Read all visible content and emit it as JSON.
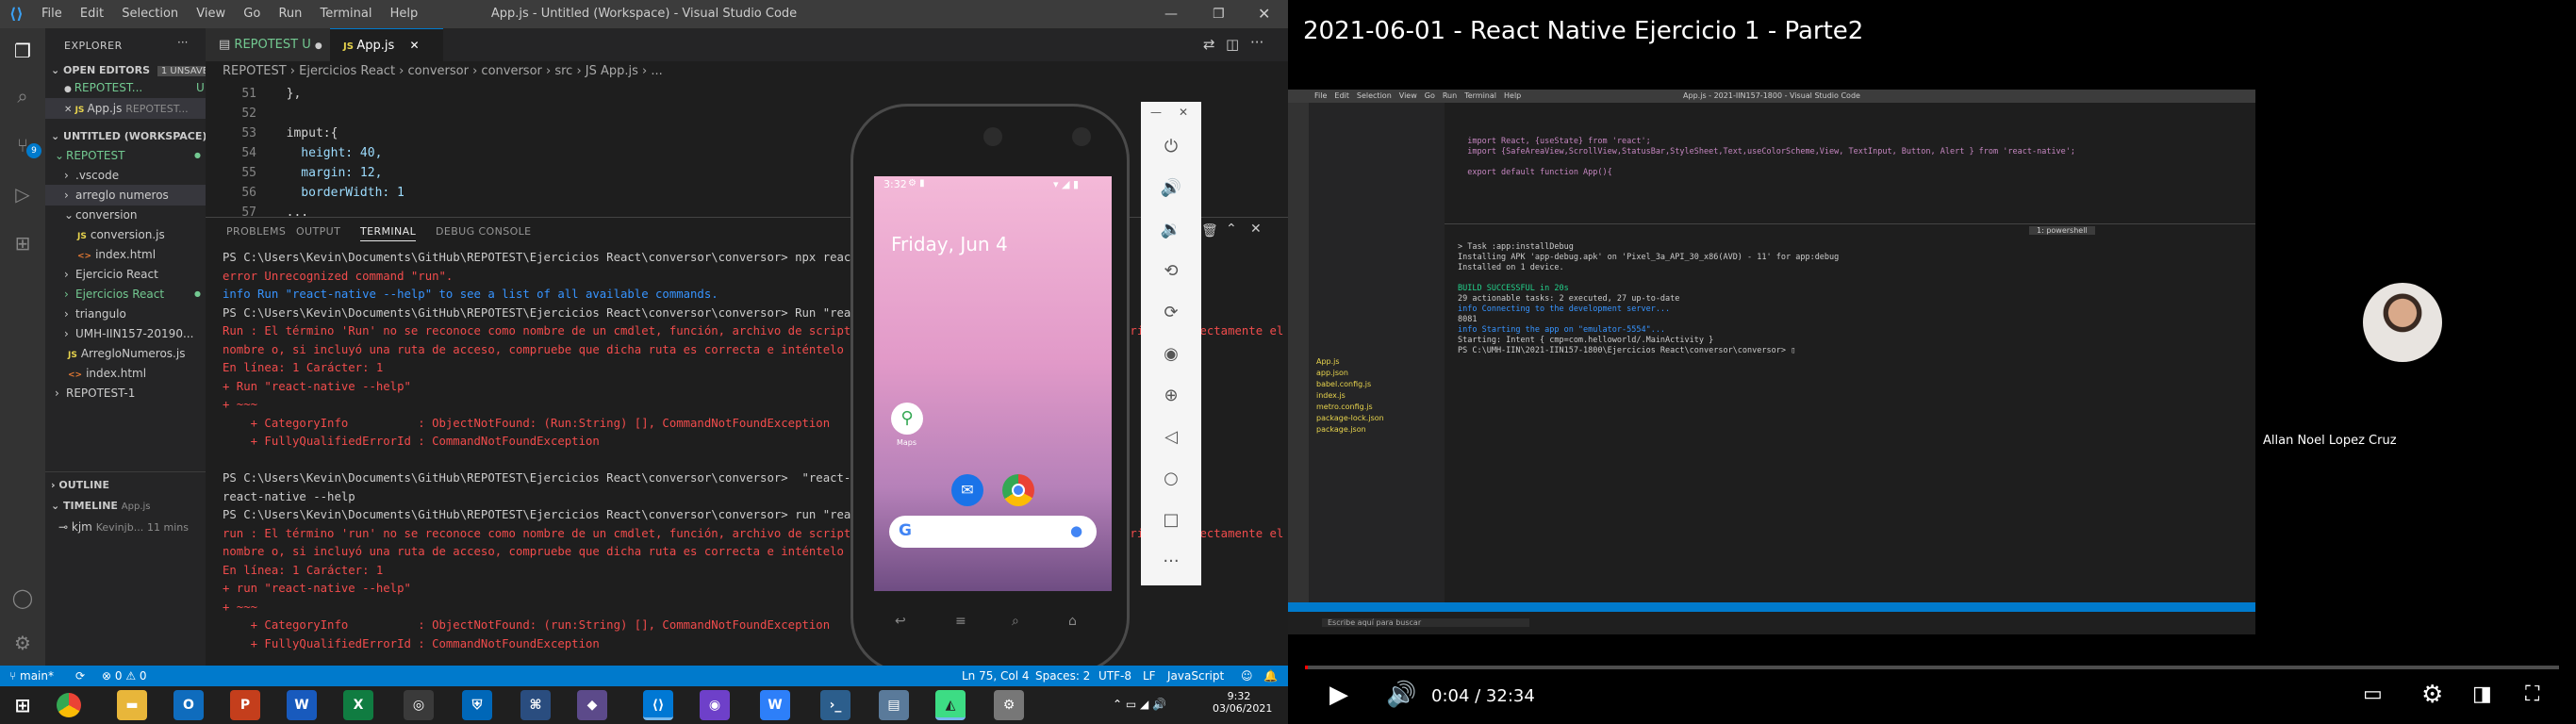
{
  "vscode": {
    "title": "App.js - Untitled (Workspace) - Visual Studio Code",
    "menu": [
      "File",
      "Edit",
      "Selection",
      "View",
      "Go",
      "Run",
      "Terminal",
      "Help"
    ],
    "explorer": {
      "header": "EXPLORER",
      "open_editors": "OPEN EDITORS",
      "unsaved": "1 UNSAVED",
      "open1_name": "REPOTEST...",
      "open1_badge": "U",
      "open2_name": "App.js",
      "open2_path": "REPOTEST...",
      "workspace": "UNTITLED (WORKSPACE)",
      "tree": [
        {
          "label": "REPOTEST",
          "arrow": "⌄",
          "indent": 1,
          "color": "#73c991",
          "dot": true
        },
        {
          "label": ".vscode",
          "arrow": "›",
          "indent": 2,
          "color": "#cccccc"
        },
        {
          "label": "arreglo numeros",
          "arrow": "›",
          "indent": 2,
          "color": "#cccccc"
        },
        {
          "label": "conversion",
          "arrow": "⌄",
          "indent": 2,
          "color": "#cccccc"
        },
        {
          "label": "conversion.js",
          "arrow": "",
          "indent": 3,
          "color": "#cccccc",
          "icon": "JS"
        },
        {
          "label": "index.html",
          "arrow": "",
          "indent": 3,
          "color": "#cccccc",
          "icon": "<>"
        },
        {
          "label": "Ejercicio React",
          "arrow": "›",
          "indent": 2,
          "color": "#cccccc"
        },
        {
          "label": "Ejercicios React",
          "arrow": "›",
          "indent": 2,
          "color": "#73c991",
          "dot": true
        },
        {
          "label": "triangulo",
          "arrow": "›",
          "indent": 2,
          "color": "#cccccc"
        },
        {
          "label": "UMH-IIN157-20190...",
          "arrow": "›",
          "indent": 2,
          "color": "#cccccc"
        },
        {
          "label": "ArregloNumeros.js",
          "arrow": "",
          "indent": 2,
          "color": "#cccccc",
          "icon": "JS"
        },
        {
          "label": "index.html",
          "arrow": "",
          "indent": 2,
          "color": "#cccccc",
          "icon": "<>"
        },
        {
          "label": "REPOTEST-1",
          "arrow": "›",
          "indent": 1,
          "color": "#cccccc"
        }
      ],
      "outline": "OUTLINE",
      "timeline": "TIMELINE",
      "timeline_file": "App.js",
      "timeline_entry": "kjm",
      "timeline_author": "Kevinjb...",
      "timeline_time": "11 mins"
    },
    "tabs": [
      {
        "label": "REPOTEST",
        "badge": "U"
      },
      {
        "label": "App.js"
      }
    ],
    "breadcrumb": "REPOTEST › Ejercicios React › conversor › conversor › src › JS App.js › ...",
    "code": [
      {
        "n": "51",
        "t": "  },"
      },
      {
        "n": "52",
        "t": ""
      },
      {
        "n": "53",
        "t": "  imput:{"
      },
      {
        "n": "54",
        "t": "    height: 40,"
      },
      {
        "n": "55",
        "t": "    margin: 12,"
      },
      {
        "n": "56",
        "t": "    borderWidth: 1"
      },
      {
        "n": "57",
        "t": "  ..."
      }
    ],
    "panel_tabs": [
      "PROBLEMS",
      "OUTPUT",
      "TERMINAL",
      "DEBUG CONSOLE"
    ],
    "terminal": [
      {
        "c": "",
        "t": "PS C:\\Users\\Kevin\\Documents\\GitHub\\REPOTEST\\Ejercicios React\\conversor\\conversor> npx react-native run"
      },
      {
        "c": "err",
        "t": "error Unrecognized command \"run\"."
      },
      {
        "c": "inf",
        "t": "info Run \"react-native --help\" to see a list of all available commands."
      },
      {
        "c": "",
        "t": "PS C:\\Users\\Kevin\\Documents\\GitHub\\REPOTEST\\Ejercicios React\\conversor\\conversor> Run \"react-native --help\""
      },
      {
        "c": "err",
        "t": "Run : El término 'Run' no se reconoce como nombre de un cmdlet, función, archivo de script o programa ejecutable. Compruebe si escribió correctamente el"
      },
      {
        "c": "err",
        "t": "nombre o, si incluyó una ruta de acceso, compruebe que dicha ruta es correcta e inténtelo de nuevo."
      },
      {
        "c": "err",
        "t": "En línea: 1 Carácter: 1"
      },
      {
        "c": "err",
        "t": "+ Run \"react-native --help\""
      },
      {
        "c": "err",
        "t": "+ ~~~"
      },
      {
        "c": "err",
        "t": "    + CategoryInfo          : ObjectNotFound: (Run:String) [], CommandNotFoundException"
      },
      {
        "c": "err",
        "t": "    + FullyQualifiedErrorId : CommandNotFoundException"
      },
      {
        "c": "",
        "t": ""
      },
      {
        "c": "",
        "t": "PS C:\\Users\\Kevin\\Documents\\GitHub\\REPOTEST\\Ejercicios React\\conversor\\conversor>  \"react-native"
      },
      {
        "c": "",
        "t": "react-native --help"
      },
      {
        "c": "",
        "t": "PS C:\\Users\\Kevin\\Documents\\GitHub\\REPOTEST\\Ejercicios React\\conversor\\conversor> run \"react-native --help\""
      },
      {
        "c": "err",
        "t": "run : El término 'run' no se reconoce como nombre de un cmdlet, función, archivo de script o programa ejecutable. Compruebe si escribió correctamente el"
      },
      {
        "c": "err",
        "t": "nombre o, si incluyó una ruta de acceso, compruebe que dicha ruta es correcta e inténtelo de nuevo."
      },
      {
        "c": "err",
        "t": "En línea: 1 Carácter: 1"
      },
      {
        "c": "err",
        "t": "+ run \"react-native --help\""
      },
      {
        "c": "err",
        "t": "+ ~~~"
      },
      {
        "c": "err",
        "t": "    + CategoryInfo          : ObjectNotFound: (run:String) [], CommandNotFoundException"
      },
      {
        "c": "err",
        "t": "    + FullyQualifiedErrorId : CommandNotFoundException"
      },
      {
        "c": "",
        "t": ""
      },
      {
        "c": "",
        "t": "PS C:\\Users\\Kevin\\Documents\\GitHub\\REPOTEST\\Ejercicios React\\conversor\\conversor> ▯"
      }
    ],
    "status": {
      "branch": "main*",
      "errors": "⊗ 0",
      "warnings": "⚠ 0",
      "position": "Ln 75, Col 4",
      "spaces": "Spaces: 2",
      "encoding": "UTF-8",
      "eol": "LF",
      "language": "JavaScript"
    },
    "phone": {
      "time": "3:32",
      "date": "Friday, Jun 4",
      "maps_label": "Maps"
    },
    "clock": {
      "time": "9:32",
      "date": "03/06/2021"
    }
  },
  "youtube": {
    "title": "2021-06-01 - React Native Ejercicio 1 - Parte2",
    "time": "0:04 / 32:34",
    "progress": 0.002,
    "presenter": "Allan Noel Lopez Cruz",
    "video": {
      "title": "App.js - 2021-IIN157-1800 - Visual Studio Code",
      "menu": [
        "File",
        "Edit",
        "Selection",
        "View",
        "Go",
        "Run",
        "Terminal",
        "Help"
      ],
      "code": [
        "  import React, {useState} from 'react';",
        "  import {SafeAreaView,ScrollView,StatusBar,StyleSheet,Text,useColorScheme,View, TextInput, Button, Alert } from 'react-native';",
        "",
        "  export default function App(){"
      ],
      "terminal": [
        "> Task :app:installDebug",
        "Installing APK 'app-debug.apk' on 'Pixel_3a_API_30_x86(AVD) - 11' for app:debug",
        "Installed on 1 device.",
        "",
        "BUILD SUCCESSFUL in 20s",
        "29 actionable tasks: 2 executed, 27 up-to-date",
        "info Connecting to the development server...",
        "8081",
        "info Starting the app on \"emulator-5554\"...",
        "Starting: Intent { cmp=com.helloworld/.MainActivity }",
        "PS C:\\UMH-IIN\\2021-IIN157-1800\\Ejercicios React\\conversor\\conversor> ▯"
      ],
      "files": [
        "App.js",
        "app.json",
        "babel.config.js",
        "index.js",
        "metro.config.js",
        "package-lock.json",
        "package.json"
      ],
      "search": "Escribe aquí para buscar",
      "shell": "1: powershell"
    }
  }
}
